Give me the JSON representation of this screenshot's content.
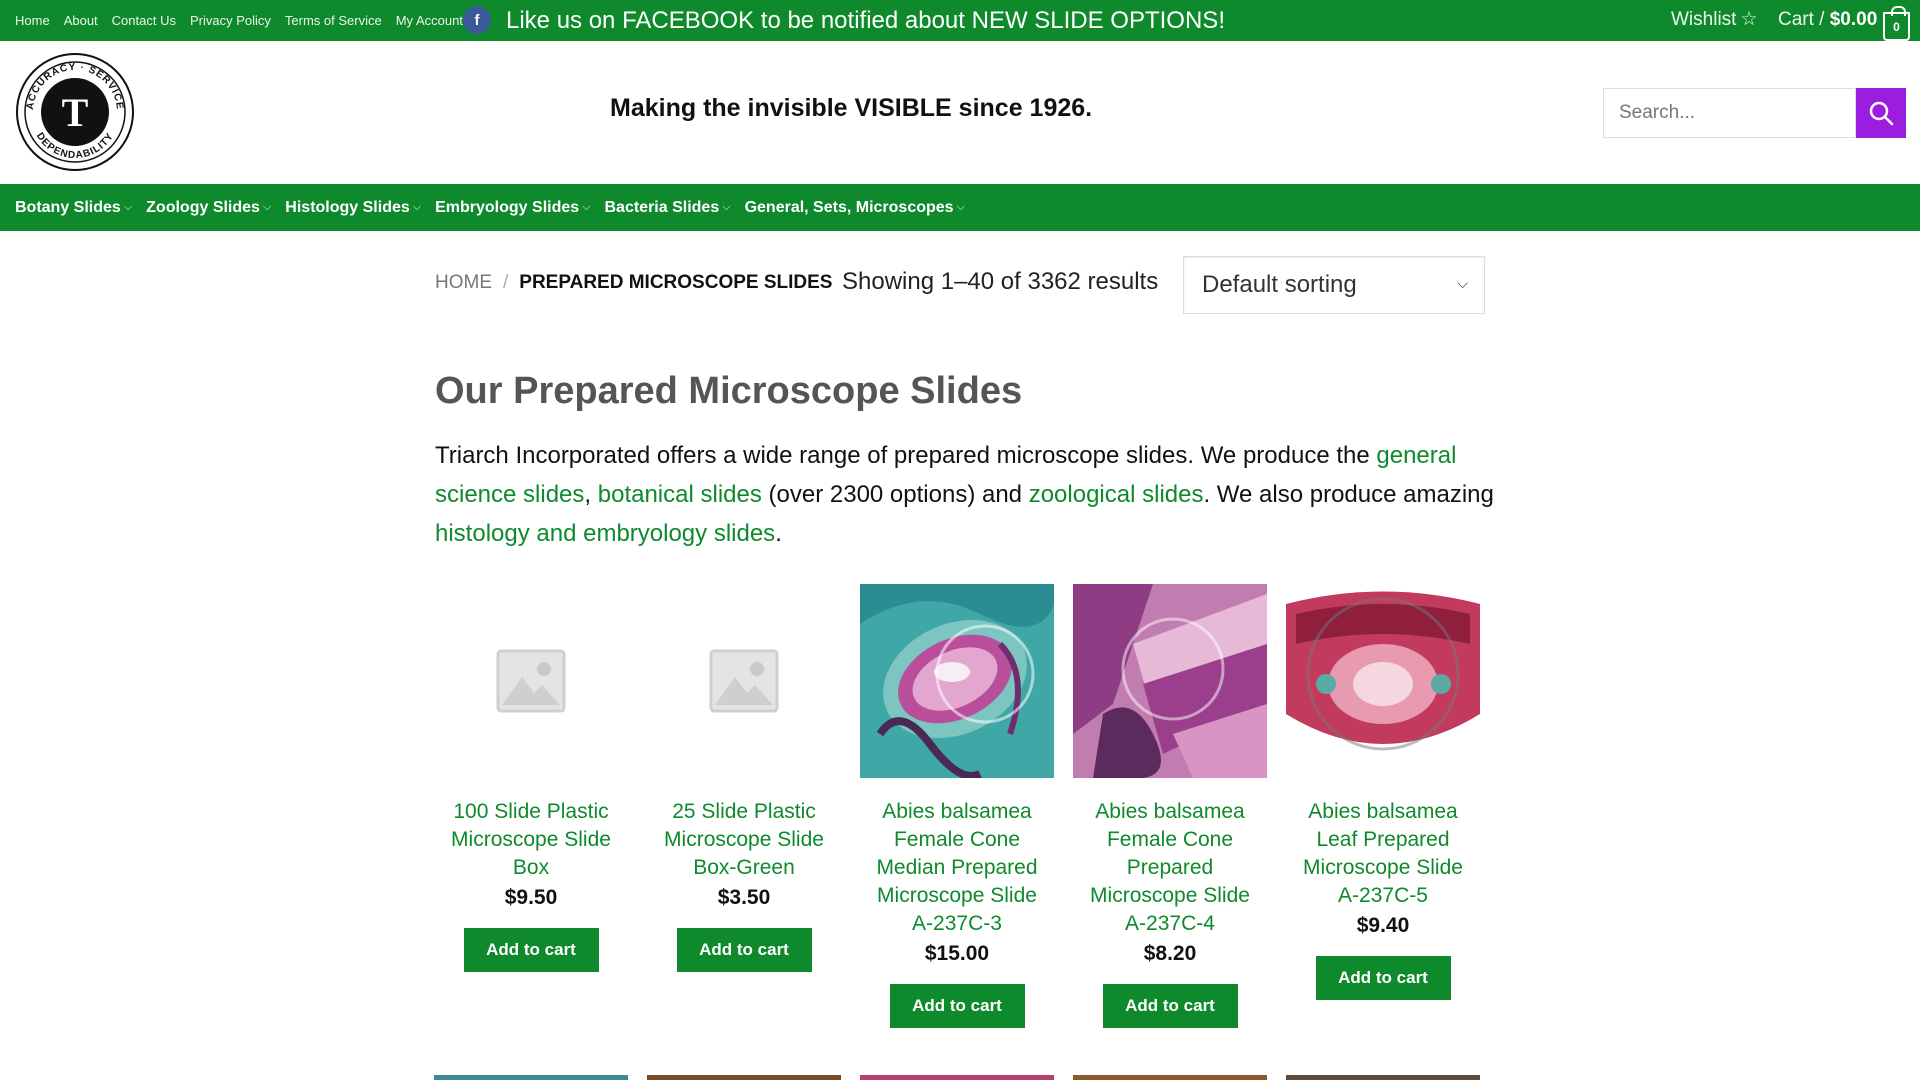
{
  "topbar": {
    "links": [
      "Home",
      "About",
      "Contact Us",
      "Privacy Policy",
      "Terms of Service",
      "My Account"
    ],
    "facebook_letter": "f",
    "promo": "Like us on FACEBOOK to be notified about NEW SLIDE OPTIONS!",
    "wishlist_label": "Wishlist",
    "cart_label": "Cart /",
    "cart_total": "$0.00",
    "cart_count": "0"
  },
  "header": {
    "logo_letter": "T",
    "logo_top_text": "ACCURACY · SERVICE",
    "logo_bottom_text": "DEPENDABILITY",
    "tagline": "Making the invisible VISIBLE since 1926.",
    "search_placeholder": "Search..."
  },
  "mainnav": {
    "items": [
      "Botany Slides",
      "Zoology Slides",
      "Histology Slides",
      "Embryology Slides",
      "Bacteria Slides",
      "General, Sets, Microscopes"
    ]
  },
  "breadcrumb": {
    "home": "HOME",
    "separator": "/",
    "current": "PREPARED MICROSCOPE SLIDES"
  },
  "results_text": "Showing 1–40 of 3362 results",
  "sort": {
    "selected": "Default sorting"
  },
  "heading": "Our Prepared Microscope Slides",
  "intro": {
    "t1": "Triarch Incorporated offers a wide range of prepared microscope slides.  We produce the ",
    "l1": "general science slides",
    "t2": ", ",
    "l2": "botanical slides",
    "t3": " (over 2300 options) and ",
    "l3": "zoological slides",
    "t4": ".  We also produce amazing ",
    "l4": "histology and embryology slides",
    "t5": "."
  },
  "products": [
    {
      "name": "100 Slide Plastic Microscope Slide Box",
      "price": "$9.50",
      "button": "Add to cart",
      "image": "placeholder"
    },
    {
      "name": "25 Slide Plastic Microscope Slide Box-Green",
      "price": "$3.50",
      "button": "Add to cart",
      "image": "placeholder"
    },
    {
      "name": "Abies balsamea Female Cone Median Prepared Microscope Slide A-237C-3",
      "price": "$15.00",
      "button": "Add to cart",
      "image": "micrograph"
    },
    {
      "name": "Abies balsamea Female Cone Prepared Microscope Slide A-237C-4",
      "price": "$8.20",
      "button": "Add to cart",
      "image": "micrograph"
    },
    {
      "name": "Abies balsamea Leaf Prepared Microscope Slide A-237C-5",
      "price": "$9.40",
      "button": "Add to cart",
      "image": "micrograph"
    }
  ],
  "colors": {
    "brand_green": "#0e8a2c",
    "search_purple": "#9b1de0",
    "facebook_blue": "#3b5998"
  }
}
